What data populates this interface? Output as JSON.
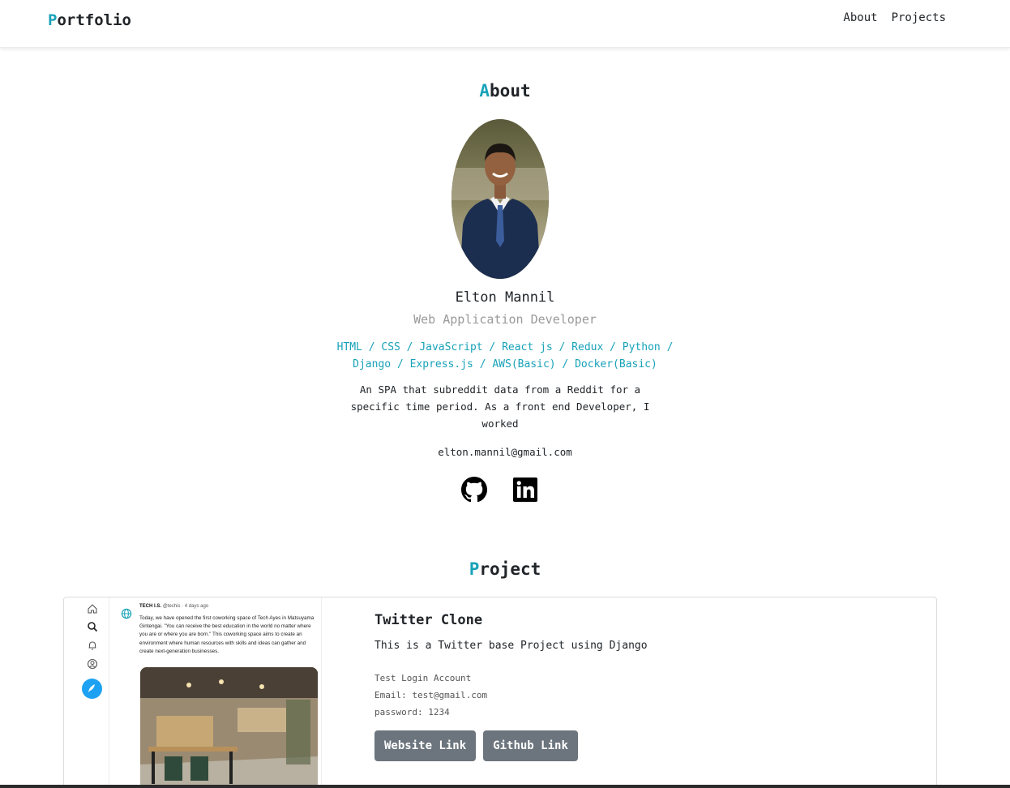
{
  "nav": {
    "brand_first": "P",
    "brand_rest": "ortfolio",
    "links": [
      "About",
      "Projects"
    ]
  },
  "about": {
    "title_first": "A",
    "title_rest": "bout",
    "name": "Elton Mannil",
    "role": "Web Application Developer",
    "skills": "HTML / CSS / JavaScript / React js / Redux / Python / Django / Express.js / AWS(Basic) / Docker(Basic)",
    "description": "An SPA that subreddit data from a Reddit for a specific time period. As a front end Developer, I worked",
    "email": "elton.mannil@gmail.com"
  },
  "project_section": {
    "title_first": "P",
    "title_rest": "roject"
  },
  "project": {
    "title": "Twitter Clone",
    "subtitle": "This is a Twitter base Project using Django",
    "meta": [
      "Test Login Account",
      "Email: test@gmail.com",
      "password: 1234"
    ],
    "website_label": "Website Link",
    "github_label": "Github Link",
    "screenshot": {
      "handle_name": "TECH I.S.",
      "handle_meta": "@techis · 4 days ago",
      "tweet": "Today, we have opened the first coworking space of Tech Ayes in Matsuyama Gintengai. \"You can receive the best education in the world no matter where you are or where you are born.\" This coworking space aims to create an environment where human resources with skills and ideas can gather and create next-generation businesses."
    }
  },
  "colors": {
    "accent": "#17a2b8",
    "button": "#6c757d",
    "muted": "#9a9a9a"
  }
}
